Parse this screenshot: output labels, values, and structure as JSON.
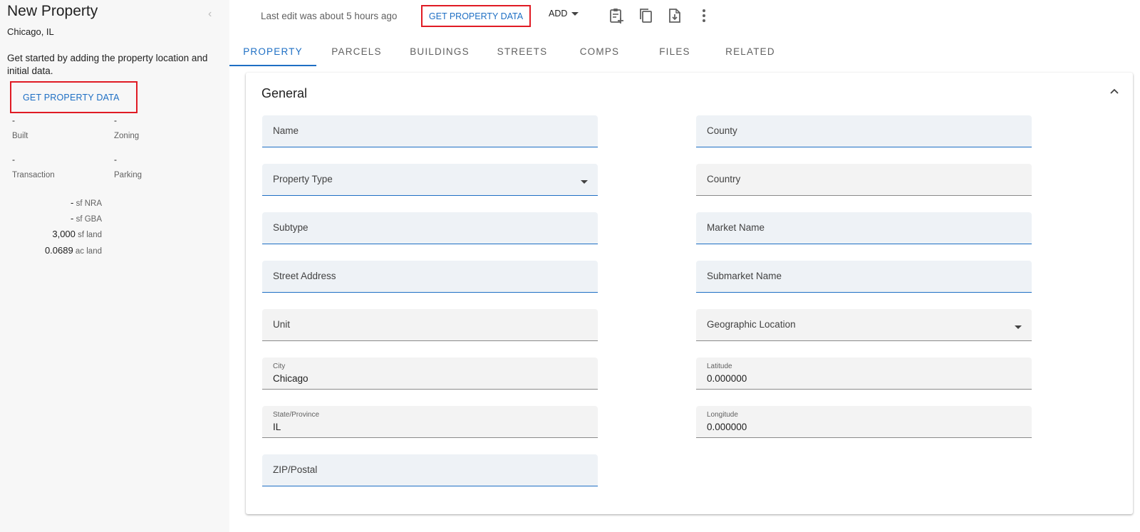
{
  "sidebar": {
    "title": "New Property",
    "location": "Chicago, IL",
    "description": "Get started by adding the property location and initial data.",
    "get_data_label": "GET PROPERTY DATA",
    "stats": [
      {
        "value": "-",
        "label": "Built"
      },
      {
        "value": "-",
        "label": "Zoning"
      },
      {
        "value": "-",
        "label": "Transaction"
      },
      {
        "value": "-",
        "label": "Parking"
      }
    ],
    "areas": [
      {
        "num": "-",
        "unit": "sf NRA"
      },
      {
        "num": "-",
        "unit": "sf GBA"
      },
      {
        "num": "3,000",
        "unit": "sf land"
      },
      {
        "num": "0.0689",
        "unit": "ac land"
      }
    ]
  },
  "toolbar": {
    "last_edit": "Last edit was about 5 hours ago",
    "get_data_label": "GET PROPERTY DATA",
    "add_label": "ADD"
  },
  "tabs": [
    {
      "label": "PROPERTY",
      "active": true
    },
    {
      "label": "PARCELS"
    },
    {
      "label": "BUILDINGS"
    },
    {
      "label": "STREETS"
    },
    {
      "label": "COMPS"
    },
    {
      "label": "FILES"
    },
    {
      "label": "RELATED"
    }
  ],
  "card": {
    "title": "General",
    "left_fields": [
      {
        "label": "Name"
      },
      {
        "label": "Property Type",
        "dropdown": true
      },
      {
        "label": "Subtype"
      },
      {
        "label": "Street Address"
      },
      {
        "label": "Unit"
      },
      {
        "label": "City",
        "value": "Chicago"
      },
      {
        "label": "State/Province",
        "value": "IL"
      },
      {
        "label": "ZIP/Postal"
      }
    ],
    "right_fields": [
      {
        "label": "County"
      },
      {
        "label": "Country"
      },
      {
        "label": "Market Name"
      },
      {
        "label": "Submarket Name"
      },
      {
        "label": "Geographic Location",
        "dropdown": true
      },
      {
        "label": "Latitude",
        "value": "0.000000"
      },
      {
        "label": "Longitude",
        "value": "0.000000"
      }
    ]
  },
  "colors": {
    "accent": "#1e6fc4",
    "highlight_box": "#e01b24",
    "field_bg": "#eef2f6",
    "sidebar_bg": "#f7f7f7"
  }
}
